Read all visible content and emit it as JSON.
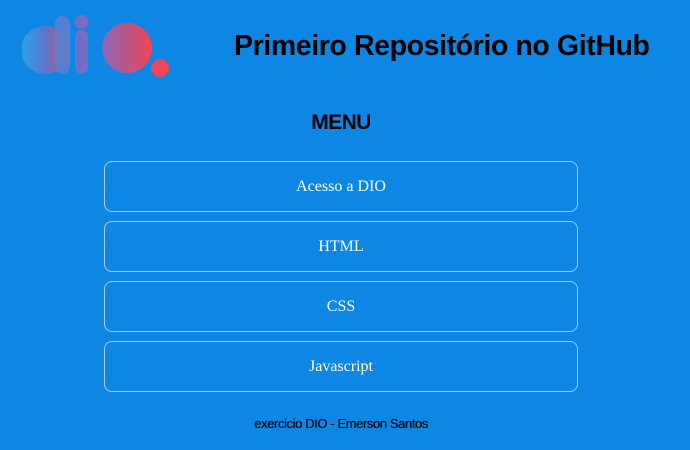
{
  "header": {
    "logo_icon": "dio-logo-icon",
    "title": "Primeiro Repositório no GitHub"
  },
  "menu": {
    "heading": "MENU",
    "items": [
      {
        "label": "Acesso a DIO"
      },
      {
        "label": "HTML"
      },
      {
        "label": "CSS"
      },
      {
        "label": "Javascript"
      }
    ]
  },
  "footer": {
    "text": "exercicio DIO - Emerson Santos"
  },
  "colors": {
    "background": "#0d86e4",
    "logo_gradient_start": "#2fa6e6",
    "logo_gradient_end": "#ee4c5a",
    "text_dark": "#000000",
    "text_light": "#ffffff"
  }
}
